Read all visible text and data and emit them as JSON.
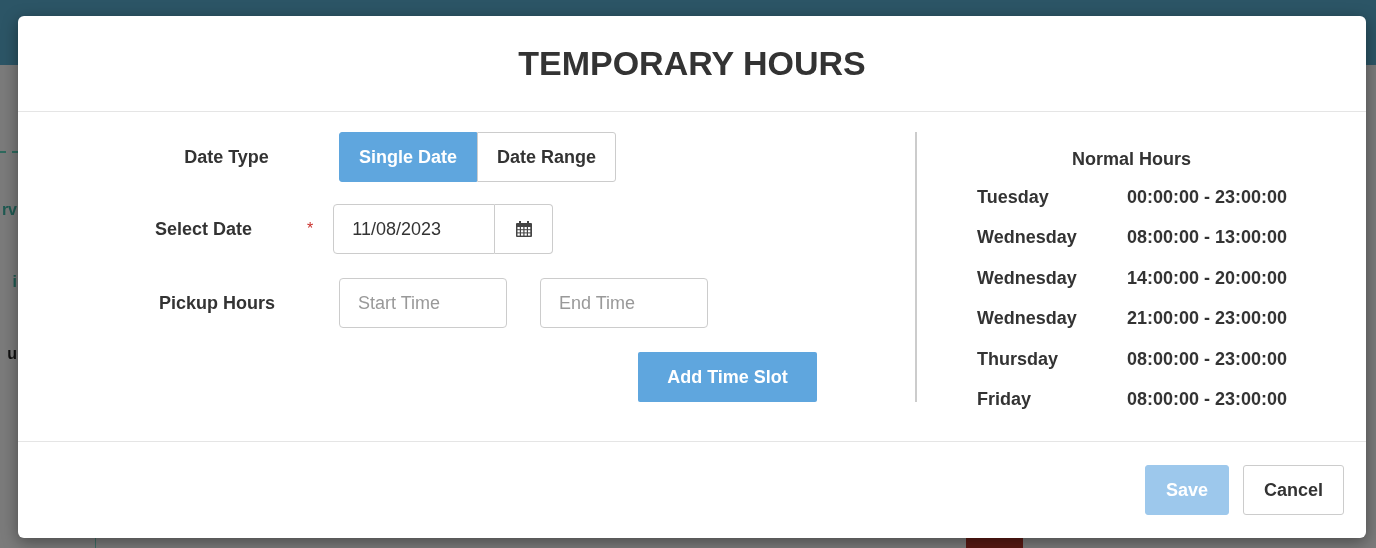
{
  "background": {
    "fragments": [
      {
        "text": "rv",
        "kind": "link"
      },
      {
        "text": "i",
        "kind": "link"
      },
      {
        "text": "u",
        "kind": "label"
      }
    ]
  },
  "dialog": {
    "title": "TEMPORARY HOURS",
    "date_type": {
      "label": "Date Type",
      "options": [
        {
          "label": "Single Date",
          "selected": true
        },
        {
          "label": "Date Range",
          "selected": false
        }
      ]
    },
    "select_date": {
      "label": "Select Date",
      "required_mark": "*",
      "value": "11/08/2023"
    },
    "pickup_hours": {
      "label": "Pickup Hours",
      "start_placeholder": "Start Time",
      "end_placeholder": "End Time"
    },
    "add_button": "Add Time Slot",
    "normal_hours": {
      "title": "Normal Hours",
      "rows": [
        {
          "day": "Tuesday",
          "hours": "00:00:00 - 23:00:00"
        },
        {
          "day": "Wednesday",
          "hours": "08:00:00 - 13:00:00"
        },
        {
          "day": "Wednesday",
          "hours": "14:00:00 - 20:00:00"
        },
        {
          "day": "Wednesday",
          "hours": "21:00:00 - 23:00:00"
        },
        {
          "day": "Thursday",
          "hours": "08:00:00 - 23:00:00"
        },
        {
          "day": "Friday",
          "hours": "08:00:00 - 23:00:00"
        }
      ]
    },
    "buttons": [
      {
        "label": "Save",
        "disabled": true
      },
      {
        "label": "Cancel",
        "disabled": false
      }
    ]
  }
}
